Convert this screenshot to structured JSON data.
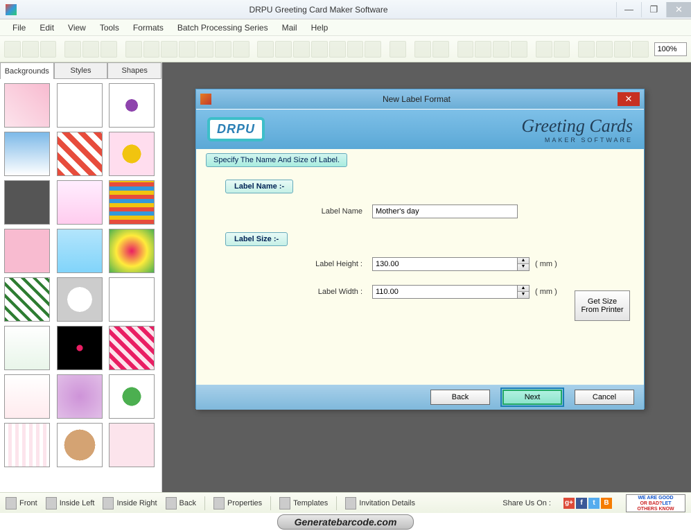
{
  "window": {
    "title": "DRPU Greeting Card Maker Software"
  },
  "menu": {
    "items": [
      "File",
      "Edit",
      "View",
      "Tools",
      "Formats",
      "Batch Processing Series",
      "Mail",
      "Help"
    ]
  },
  "toolbar": {
    "zoom": "100%"
  },
  "sidebar": {
    "tabs": [
      "Backgrounds",
      "Styles",
      "Shapes"
    ],
    "active_tab": 0
  },
  "dialog": {
    "title": "New Label Format",
    "brand": "DRPU",
    "product_line1": "Greeting Cards",
    "product_line2": "MAKER SOFTWARE",
    "step": "Specify The Name And Size of Label.",
    "section_name": "Label Name :-",
    "section_size": "Label Size :-",
    "label_name_label": "Label Name",
    "label_name_value": "Mother's day",
    "height_label": "Label Height :",
    "height_value": "130.00",
    "height_unit": "( mm )",
    "width_label": "Label Width :",
    "width_value": "110.00",
    "width_unit": "( mm )",
    "get_size": "Get Size From Printer",
    "back": "Back",
    "next": "Next",
    "cancel": "Cancel"
  },
  "bottom": {
    "pages": [
      "Front",
      "Inside Left",
      "Inside Right",
      "Back"
    ],
    "props": "Properties",
    "templates": "Templates",
    "invitation": "Invitation Details",
    "share": "Share Us On :",
    "feedback_good": "WE ARE GOOD",
    "feedback_bad": "OR BAD?",
    "feedback_let": "LET",
    "feedback_know": "OTHERS KNOW"
  },
  "watermark": "Generatebarcode.com"
}
